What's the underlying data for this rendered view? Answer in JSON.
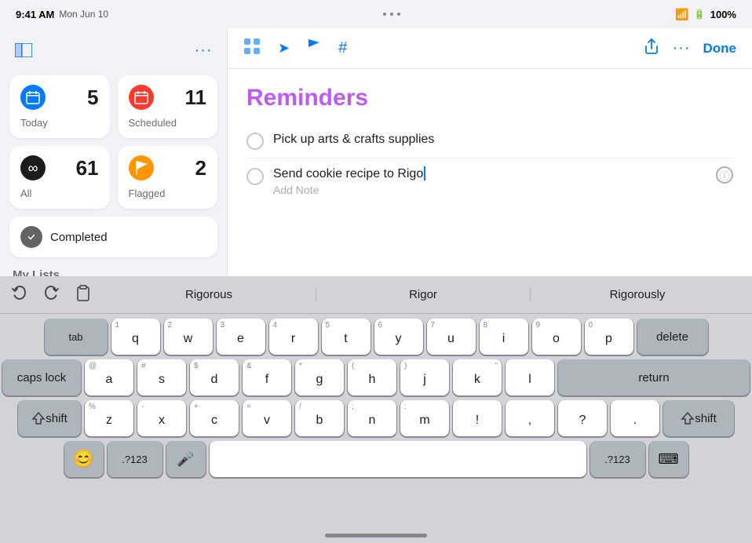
{
  "statusBar": {
    "time": "9:41 AM",
    "date": "Mon Jun 10",
    "dotsLabel": "...",
    "wifi": "wifi",
    "battery": "100%"
  },
  "sidebar": {
    "toggleIcon": "⊞",
    "ellipsisIcon": "···",
    "smartLists": [
      {
        "id": "today",
        "label": "Today",
        "count": "5",
        "iconBg": "#007aff",
        "icon": "📅"
      },
      {
        "id": "scheduled",
        "label": "Scheduled",
        "count": "11",
        "iconBg": "#ff3b30",
        "icon": "📅"
      },
      {
        "id": "all",
        "label": "All",
        "count": "61",
        "iconBg": "#1c1c1e",
        "icon": "∞"
      },
      {
        "id": "flagged",
        "label": "Flagged",
        "count": "2",
        "iconBg": "#ff9500",
        "icon": "⚑"
      }
    ],
    "completed": {
      "label": "Completed",
      "iconBg": "#636366",
      "icon": "✓"
    },
    "myListsHeader": "My Lists"
  },
  "toolbar": {
    "icons": [
      "🗂",
      "➤",
      "⚑",
      "#"
    ],
    "shareIcon": "↑",
    "ellipsisIcon": "···",
    "doneLabel": "Done"
  },
  "reminders": {
    "title": "Reminders",
    "items": [
      {
        "id": "item1",
        "text": "Pick up arts & crafts supplies",
        "editing": false
      },
      {
        "id": "item2",
        "text": "Send cookie recipe to Rigo",
        "editing": true,
        "addNotePlaceholder": "Add Note"
      }
    ]
  },
  "keyboard": {
    "suggestions": [
      "Rigorous",
      "Rigor",
      "Rigorously"
    ],
    "rows": [
      [
        "q",
        "w",
        "e",
        "r",
        "t",
        "y",
        "u",
        "i",
        "o",
        "p"
      ],
      [
        "a",
        "s",
        "d",
        "f",
        "g",
        "h",
        "j",
        "k",
        "l"
      ],
      [
        "z",
        "x",
        "c",
        "v",
        "b",
        "n",
        "m"
      ]
    ],
    "numbers": [
      "1",
      "2",
      "3",
      "4",
      "5",
      "6",
      "7",
      "8",
      "9",
      "0"
    ],
    "specialKeys": {
      "tab": "tab",
      "capsLock": "caps lock",
      "shift": "shift",
      "delete": "delete",
      "return": "return",
      "shiftRight": "shift",
      "emoji": "😊",
      "numbers": ".?123",
      "microphone": "🎤",
      "numbers2": ".?123",
      "keyboardDismiss": "⌨"
    }
  }
}
